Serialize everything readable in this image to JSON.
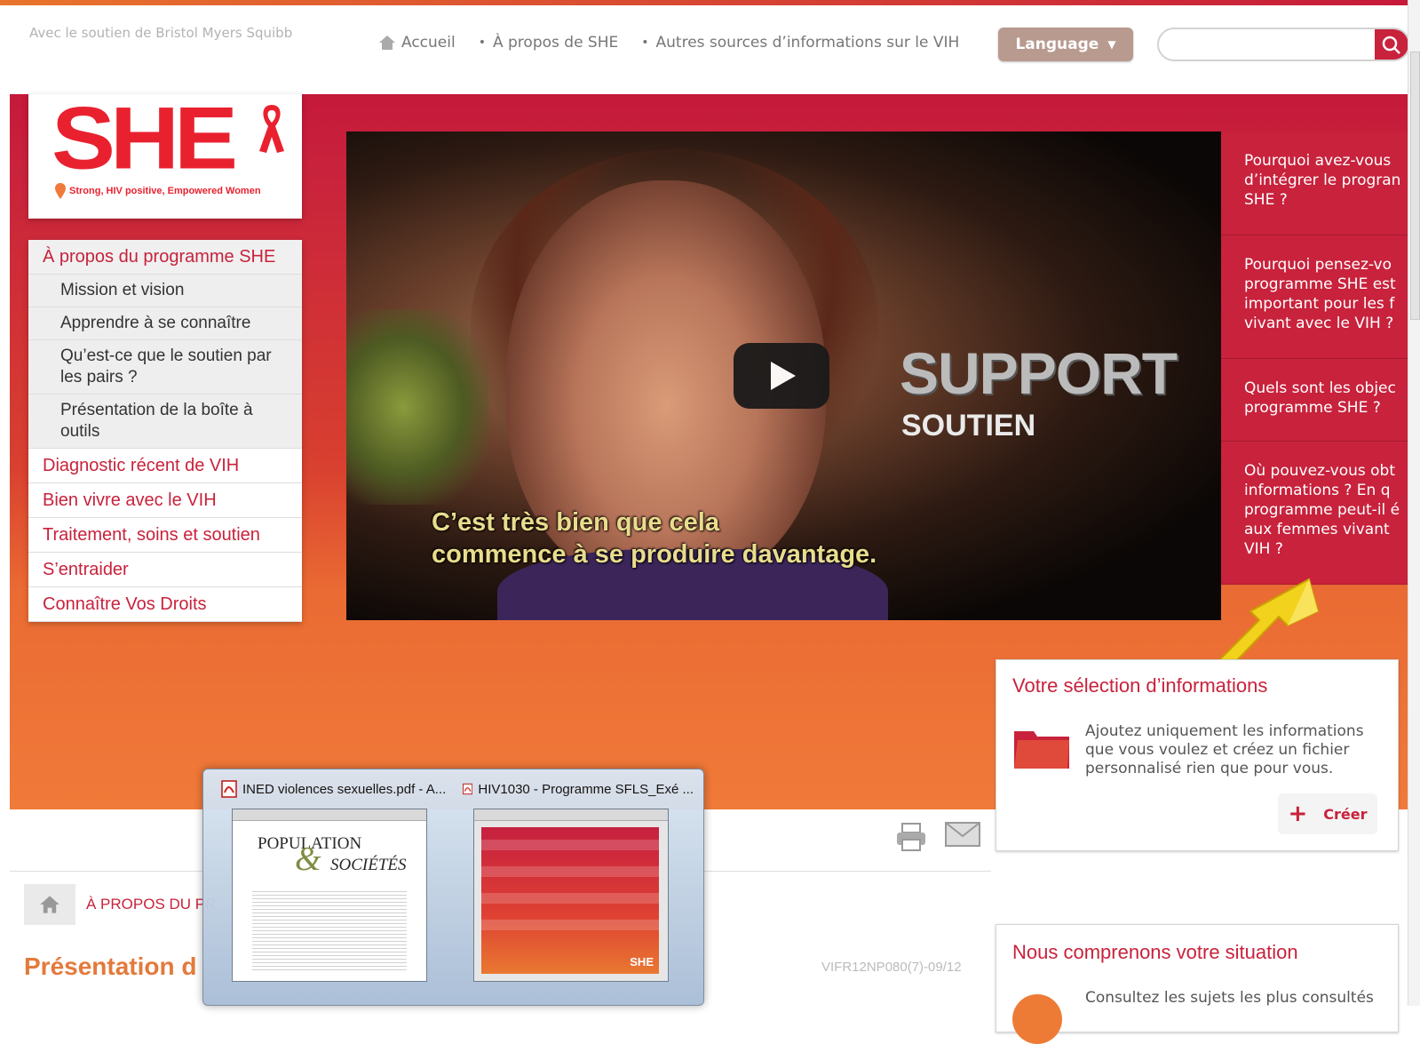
{
  "header": {
    "sponsor": "Avec le soutien de Bristol Myers Squibb",
    "nav": [
      {
        "label": "Accueil"
      },
      {
        "label": "À propos de SHE"
      },
      {
        "label": "Autres sources d’informations sur le VIH"
      }
    ],
    "language_label": "Language",
    "search_placeholder": ""
  },
  "logo": {
    "text": "SHE",
    "tagline": "Strong, HIV positive, Empowered Women"
  },
  "sidebar": {
    "items": [
      {
        "label": "À propos du programme SHE"
      },
      {
        "label": "Mission et vision"
      },
      {
        "label": "Apprendre à se connaître"
      },
      {
        "label": "Qu’est-ce que le soutien par les pairs ?"
      },
      {
        "label": "Présentation de la boîte à outils"
      },
      {
        "label": "Diagnostic récent de VIH"
      },
      {
        "label": "Bien vivre avec le VIH"
      },
      {
        "label": "Traitement, soins et soutien"
      },
      {
        "label": "S’entraider"
      },
      {
        "label": "Connaître Vos Droits"
      }
    ]
  },
  "video": {
    "overlay_title": "SUPPORT",
    "overlay_subtitle": "SOUTIEN",
    "caption_line1": "C’est très bien que cela",
    "caption_line2": "commence à se produire davantage."
  },
  "questions": [
    {
      "text": "Pourquoi avez-vous\nd’intégrer le progran\nSHE ?"
    },
    {
      "text": "Pourquoi pensez-vo\nprogramme SHE est\nimportant pour les f\nvivant avec le VIH ?"
    },
    {
      "text": "Quels sont les objec\nprogramme SHE ?"
    },
    {
      "text": "Où pouvez-vous obt\ninformations ? En q\nprogramme peut-il é\naux femmes vivant\nVIH ?"
    }
  ],
  "selection_card": {
    "title": "Votre sélection d’informations",
    "text": "Ajoutez uniquement les informations que vous voulez et créez un fichier personnalisé rien que pour vous.",
    "create_label": "Créer"
  },
  "breadcrumb": {
    "text": "À PROPOS DU PR"
  },
  "page": {
    "title": "Présentation d",
    "doc_ref": "VIFR12NP080(7)-09/12"
  },
  "situation_card": {
    "title": "Nous comprenons votre situation",
    "text": "Consultez les sujets les plus consultés"
  },
  "taskbar_preview": {
    "items": [
      {
        "title": "INED violences sexuelles.pdf - A...",
        "preview_heading": "POPULATION",
        "preview_sub": "SOCIÉTÉS"
      },
      {
        "title": "HIV1030 - Programme SFLS_Exé ...",
        "preview_logo": "SHE"
      }
    ]
  },
  "colors": {
    "brand_red": "#c8223c",
    "brand_orange": "#f07a39",
    "title_orange": "#e37a3c"
  }
}
